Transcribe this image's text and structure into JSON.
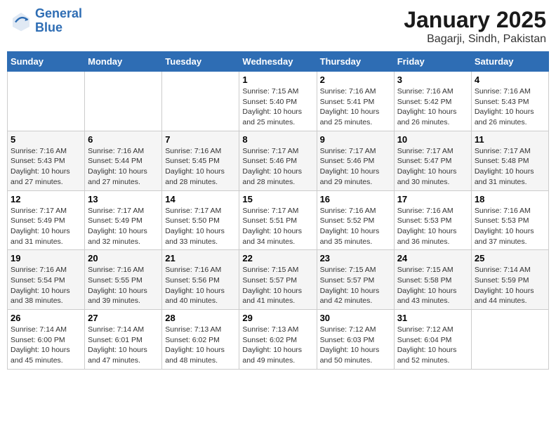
{
  "header": {
    "logo_line1": "General",
    "logo_line2": "Blue",
    "month_title": "January 2025",
    "location": "Bagarji, Sindh, Pakistan"
  },
  "weekdays": [
    "Sunday",
    "Monday",
    "Tuesday",
    "Wednesday",
    "Thursday",
    "Friday",
    "Saturday"
  ],
  "weeks": [
    [
      {
        "day": "",
        "sunrise": "",
        "sunset": "",
        "daylight": ""
      },
      {
        "day": "",
        "sunrise": "",
        "sunset": "",
        "daylight": ""
      },
      {
        "day": "",
        "sunrise": "",
        "sunset": "",
        "daylight": ""
      },
      {
        "day": "1",
        "sunrise": "Sunrise: 7:15 AM",
        "sunset": "Sunset: 5:40 PM",
        "daylight": "Daylight: 10 hours and 25 minutes."
      },
      {
        "day": "2",
        "sunrise": "Sunrise: 7:16 AM",
        "sunset": "Sunset: 5:41 PM",
        "daylight": "Daylight: 10 hours and 25 minutes."
      },
      {
        "day": "3",
        "sunrise": "Sunrise: 7:16 AM",
        "sunset": "Sunset: 5:42 PM",
        "daylight": "Daylight: 10 hours and 26 minutes."
      },
      {
        "day": "4",
        "sunrise": "Sunrise: 7:16 AM",
        "sunset": "Sunset: 5:43 PM",
        "daylight": "Daylight: 10 hours and 26 minutes."
      }
    ],
    [
      {
        "day": "5",
        "sunrise": "Sunrise: 7:16 AM",
        "sunset": "Sunset: 5:43 PM",
        "daylight": "Daylight: 10 hours and 27 minutes."
      },
      {
        "day": "6",
        "sunrise": "Sunrise: 7:16 AM",
        "sunset": "Sunset: 5:44 PM",
        "daylight": "Daylight: 10 hours and 27 minutes."
      },
      {
        "day": "7",
        "sunrise": "Sunrise: 7:16 AM",
        "sunset": "Sunset: 5:45 PM",
        "daylight": "Daylight: 10 hours and 28 minutes."
      },
      {
        "day": "8",
        "sunrise": "Sunrise: 7:17 AM",
        "sunset": "Sunset: 5:46 PM",
        "daylight": "Daylight: 10 hours and 28 minutes."
      },
      {
        "day": "9",
        "sunrise": "Sunrise: 7:17 AM",
        "sunset": "Sunset: 5:46 PM",
        "daylight": "Daylight: 10 hours and 29 minutes."
      },
      {
        "day": "10",
        "sunrise": "Sunrise: 7:17 AM",
        "sunset": "Sunset: 5:47 PM",
        "daylight": "Daylight: 10 hours and 30 minutes."
      },
      {
        "day": "11",
        "sunrise": "Sunrise: 7:17 AM",
        "sunset": "Sunset: 5:48 PM",
        "daylight": "Daylight: 10 hours and 31 minutes."
      }
    ],
    [
      {
        "day": "12",
        "sunrise": "Sunrise: 7:17 AM",
        "sunset": "Sunset: 5:49 PM",
        "daylight": "Daylight: 10 hours and 31 minutes."
      },
      {
        "day": "13",
        "sunrise": "Sunrise: 7:17 AM",
        "sunset": "Sunset: 5:49 PM",
        "daylight": "Daylight: 10 hours and 32 minutes."
      },
      {
        "day": "14",
        "sunrise": "Sunrise: 7:17 AM",
        "sunset": "Sunset: 5:50 PM",
        "daylight": "Daylight: 10 hours and 33 minutes."
      },
      {
        "day": "15",
        "sunrise": "Sunrise: 7:17 AM",
        "sunset": "Sunset: 5:51 PM",
        "daylight": "Daylight: 10 hours and 34 minutes."
      },
      {
        "day": "16",
        "sunrise": "Sunrise: 7:16 AM",
        "sunset": "Sunset: 5:52 PM",
        "daylight": "Daylight: 10 hours and 35 minutes."
      },
      {
        "day": "17",
        "sunrise": "Sunrise: 7:16 AM",
        "sunset": "Sunset: 5:53 PM",
        "daylight": "Daylight: 10 hours and 36 minutes."
      },
      {
        "day": "18",
        "sunrise": "Sunrise: 7:16 AM",
        "sunset": "Sunset: 5:53 PM",
        "daylight": "Daylight: 10 hours and 37 minutes."
      }
    ],
    [
      {
        "day": "19",
        "sunrise": "Sunrise: 7:16 AM",
        "sunset": "Sunset: 5:54 PM",
        "daylight": "Daylight: 10 hours and 38 minutes."
      },
      {
        "day": "20",
        "sunrise": "Sunrise: 7:16 AM",
        "sunset": "Sunset: 5:55 PM",
        "daylight": "Daylight: 10 hours and 39 minutes."
      },
      {
        "day": "21",
        "sunrise": "Sunrise: 7:16 AM",
        "sunset": "Sunset: 5:56 PM",
        "daylight": "Daylight: 10 hours and 40 minutes."
      },
      {
        "day": "22",
        "sunrise": "Sunrise: 7:15 AM",
        "sunset": "Sunset: 5:57 PM",
        "daylight": "Daylight: 10 hours and 41 minutes."
      },
      {
        "day": "23",
        "sunrise": "Sunrise: 7:15 AM",
        "sunset": "Sunset: 5:57 PM",
        "daylight": "Daylight: 10 hours and 42 minutes."
      },
      {
        "day": "24",
        "sunrise": "Sunrise: 7:15 AM",
        "sunset": "Sunset: 5:58 PM",
        "daylight": "Daylight: 10 hours and 43 minutes."
      },
      {
        "day": "25",
        "sunrise": "Sunrise: 7:14 AM",
        "sunset": "Sunset: 5:59 PM",
        "daylight": "Daylight: 10 hours and 44 minutes."
      }
    ],
    [
      {
        "day": "26",
        "sunrise": "Sunrise: 7:14 AM",
        "sunset": "Sunset: 6:00 PM",
        "daylight": "Daylight: 10 hours and 45 minutes."
      },
      {
        "day": "27",
        "sunrise": "Sunrise: 7:14 AM",
        "sunset": "Sunset: 6:01 PM",
        "daylight": "Daylight: 10 hours and 47 minutes."
      },
      {
        "day": "28",
        "sunrise": "Sunrise: 7:13 AM",
        "sunset": "Sunset: 6:02 PM",
        "daylight": "Daylight: 10 hours and 48 minutes."
      },
      {
        "day": "29",
        "sunrise": "Sunrise: 7:13 AM",
        "sunset": "Sunset: 6:02 PM",
        "daylight": "Daylight: 10 hours and 49 minutes."
      },
      {
        "day": "30",
        "sunrise": "Sunrise: 7:12 AM",
        "sunset": "Sunset: 6:03 PM",
        "daylight": "Daylight: 10 hours and 50 minutes."
      },
      {
        "day": "31",
        "sunrise": "Sunrise: 7:12 AM",
        "sunset": "Sunset: 6:04 PM",
        "daylight": "Daylight: 10 hours and 52 minutes."
      },
      {
        "day": "",
        "sunrise": "",
        "sunset": "",
        "daylight": ""
      }
    ]
  ]
}
